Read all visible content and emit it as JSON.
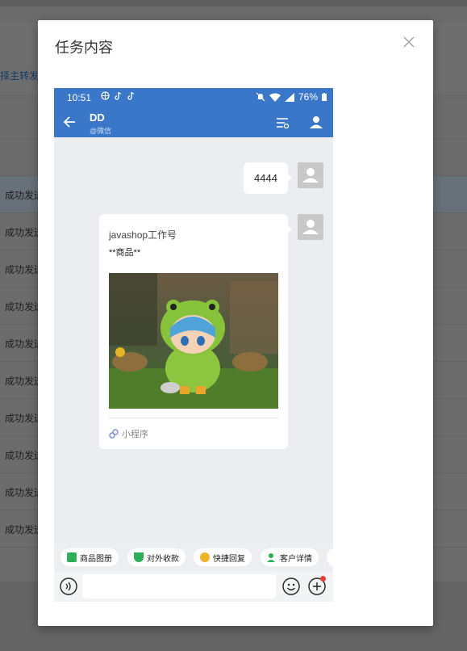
{
  "background": {
    "header_text": "择主转发到",
    "rows": [
      "成功发送",
      "成功发送",
      "成功发送",
      "成功发送",
      "成功发送",
      "成功发送",
      "成功发送",
      "成功发送",
      "成功发送",
      "成功发送"
    ]
  },
  "modal": {
    "title": "任务内容",
    "close_icon": "close-icon"
  },
  "phone": {
    "status": {
      "time": "10:51",
      "battery": "76%"
    },
    "nav": {
      "name": "DD",
      "sub": "@微信"
    },
    "messages": {
      "text": "4444",
      "card": {
        "source": "javashop工作号",
        "title": "**商品**",
        "footer": "小程序"
      }
    },
    "quick": [
      "商品图册",
      "对外收款",
      "快捷回复",
      "客户详情"
    ],
    "colors": {
      "header": "#3a77c9",
      "chat_bg": "#ebedf0"
    }
  }
}
